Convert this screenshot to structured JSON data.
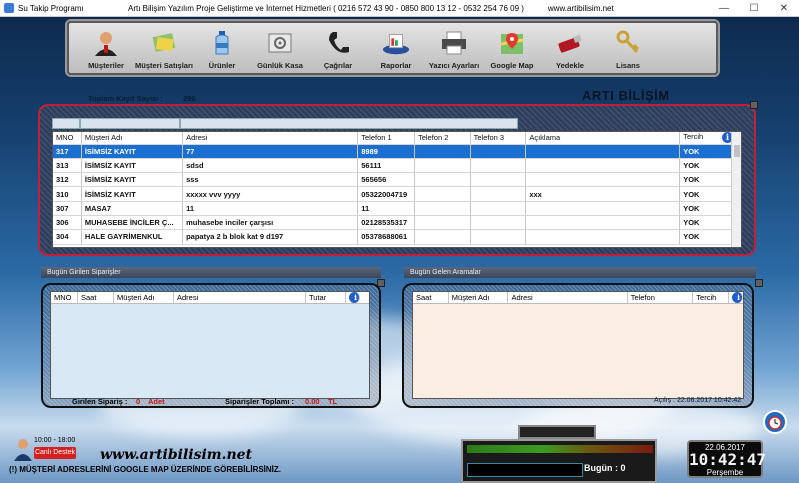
{
  "window": {
    "app_title": "Su Takip Programı",
    "company_info": "Artı Bilişim Yazılım Proje Geliştirme ve İnternet Hizmetleri ( 0216 572 43 90 - 0850 800 13 12 - 0532 254 76 09 )",
    "website": "www.artibilisim.net",
    "min_icon": "minimize-icon",
    "max_icon": "maximize-icon",
    "close_icon": "close-icon"
  },
  "toolbar": {
    "items": [
      {
        "label": "Müşteriler",
        "icon": "user-icon"
      },
      {
        "label": "Müşteri Satışları",
        "icon": "sales-icon"
      },
      {
        "label": "Ürünler",
        "icon": "water-bottle-icon"
      },
      {
        "label": "Günlük Kasa",
        "icon": "safe-icon"
      },
      {
        "label": "Çağrılar",
        "icon": "phone-icon"
      },
      {
        "label": "Raporlar",
        "icon": "reports-icon"
      },
      {
        "label": "Yazıcı Ayarları",
        "icon": "printer-icon"
      },
      {
        "label": "Google Map",
        "icon": "map-icon"
      },
      {
        "label": "Yedekle",
        "icon": "usb-drive-icon"
      },
      {
        "label": "Lisans",
        "icon": "keys-icon"
      }
    ]
  },
  "summary": {
    "total_label": "Toplam Kayıt Sayısı :",
    "total_value": "296",
    "brand": "ARTI BİLİŞİM"
  },
  "customers": {
    "columns": [
      "MNO",
      "Müşteri Adı",
      "Adresi",
      "Telefon 1",
      "Telefon 2",
      "Telefon 3",
      "Açıklama",
      "Tercih"
    ],
    "rows": [
      [
        "317",
        "İSİMSİZ KAYIT",
        "77",
        "8989",
        "",
        "",
        "",
        "YOK"
      ],
      [
        "313",
        "İSİMSİZ KAYIT",
        "sdsd",
        "56111",
        "",
        "",
        "",
        "YOK"
      ],
      [
        "312",
        "İSİMSİZ KAYIT",
        "sss",
        "565656",
        "",
        "",
        "",
        "YOK"
      ],
      [
        "310",
        "İSİMSİZ KAYIT",
        "xxxxx vvv yyyy",
        "05322004719",
        "",
        "",
        "xxx",
        "YOK"
      ],
      [
        "307",
        "MASA7",
        "11",
        "11",
        "",
        "",
        "",
        "YOK"
      ],
      [
        "306",
        "MUHASEBE İNCİLER Ç...",
        "muhasebe inciler çarşısı",
        "02128535317",
        "",
        "",
        "",
        "YOK"
      ],
      [
        "304",
        "HALE GAYRİMENKUL",
        "papatya 2 b blok kat 9 d197",
        "05378688061",
        "",
        "",
        "",
        "YOK"
      ]
    ],
    "selected_row": 0
  },
  "orders": {
    "title": "Bugün Girilen Siparişler",
    "columns": [
      "MNO",
      "Saat",
      "Müşteri Adı",
      "Adresi",
      "Tutar"
    ],
    "count_label": "Girilen Sipariş :",
    "count_value": "0",
    "count_unit": "Adet",
    "total_label": "Siparişler Toplamı :",
    "total_value": "0.00",
    "total_unit": "TL"
  },
  "calls": {
    "title": "Bugün Gelen Aramalar",
    "columns": [
      "Saat",
      "Müşteri Adı",
      "Adresi",
      "Telefon",
      "Tercih"
    ],
    "opened_text": "Açılış : 22.06.2017 10:42:42"
  },
  "footer": {
    "support_hours": "10:00 - 18:00",
    "support_button": "Canlı Destek",
    "website": "www.artibilisim.net",
    "map_note": "(!) MÜŞTERİ ADRESLERİNİ GOOGLE MAP ÜZERİNDE GÖREBİLİRSİNİZ.",
    "today_label": "Bugün : 0",
    "alarm_icon": "alarm-clock-icon"
  },
  "clock": {
    "date": "22.06.2017",
    "time": "10:42:47",
    "day": "Perşembe"
  }
}
